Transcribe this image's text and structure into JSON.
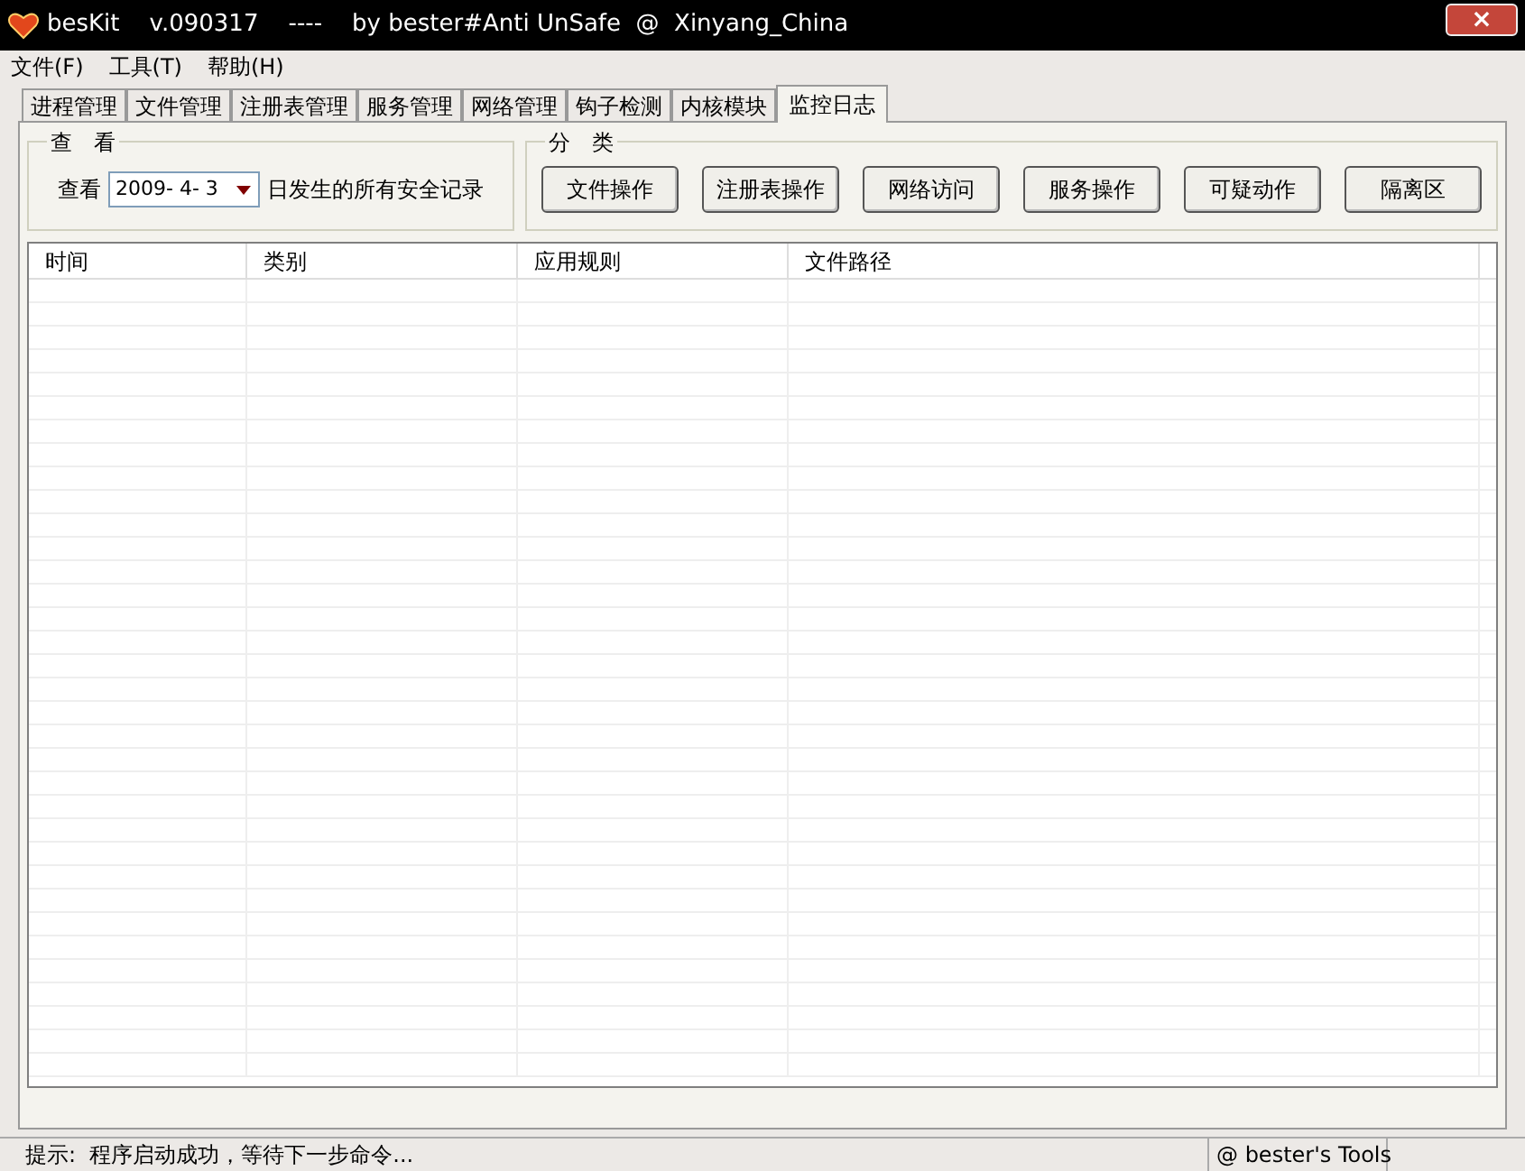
{
  "window": {
    "title": "besKit    v.090317    ----    by bester#Anti UnSafe  @  Xinyang_China",
    "close": "×"
  },
  "menu": [
    "文件(F)",
    "工具(T)",
    "帮助(H)"
  ],
  "tabs": [
    {
      "label": "进程管理",
      "selected": false
    },
    {
      "label": "文件管理",
      "selected": false
    },
    {
      "label": "注册表管理",
      "selected": false
    },
    {
      "label": "服务管理",
      "selected": false
    },
    {
      "label": "网络管理",
      "selected": false
    },
    {
      "label": "钩子检测",
      "selected": false
    },
    {
      "label": "内核模块",
      "selected": false
    },
    {
      "label": "监控日志",
      "selected": true
    }
  ],
  "view_group": {
    "title": "查　看",
    "label": "查看",
    "date": "2009- 4- 3",
    "suffix": "日发生的所有安全记录"
  },
  "category_group": {
    "title": "分　类",
    "buttons": [
      "文件操作",
      "注册表操作",
      "网络访问",
      "服务操作",
      "可疑动作",
      "隔离区"
    ]
  },
  "table": {
    "columns": [
      "时间",
      "类别",
      "应用规则",
      "文件路径"
    ]
  },
  "status_bar": {
    "message": "提示:  程序启动成功，等待下一步命令...",
    "credit": "@ bester's Tools"
  }
}
